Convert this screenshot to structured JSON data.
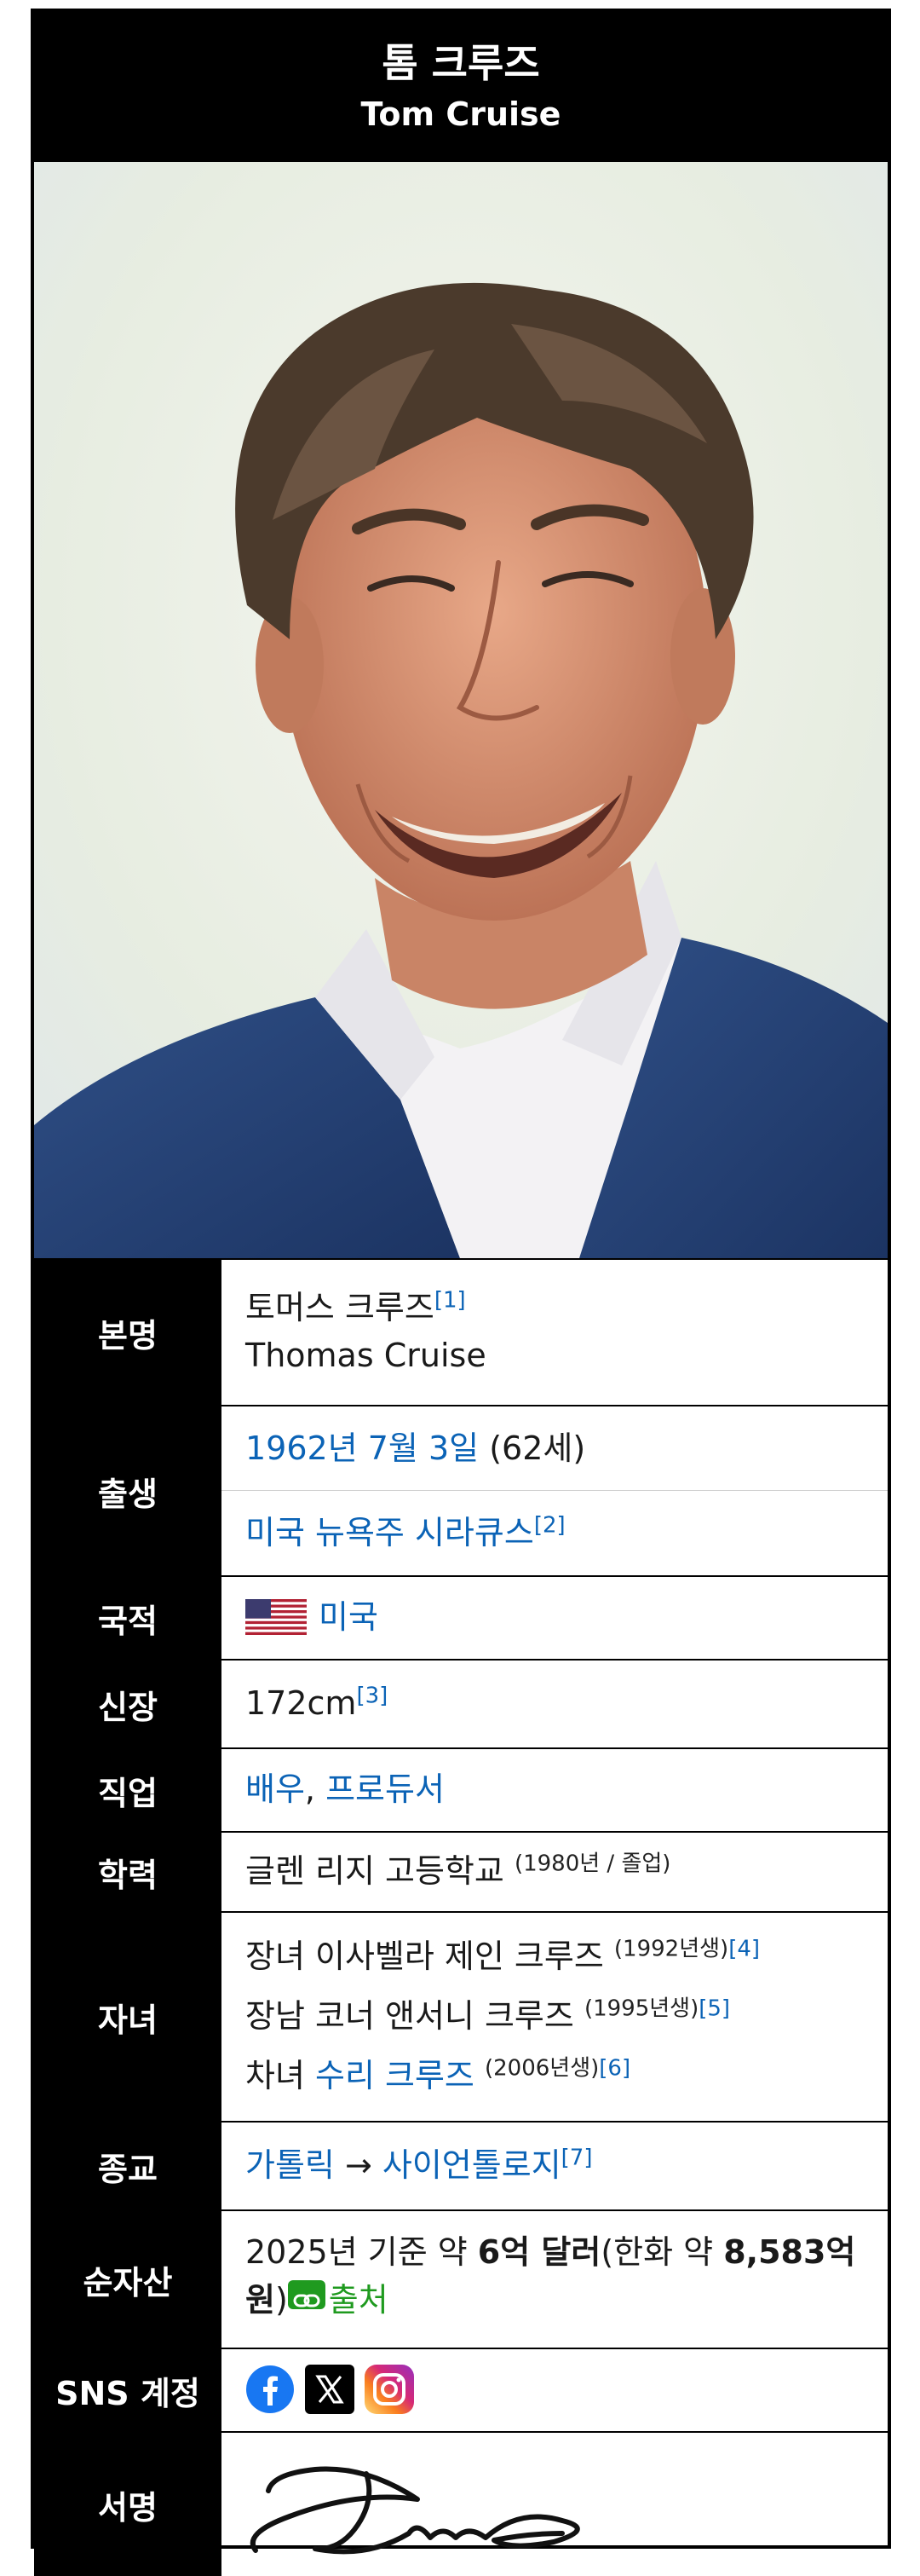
{
  "title": {
    "korean": "톰 크루즈",
    "english": "Tom Cruise"
  },
  "rows": {
    "real_name": {
      "label": "본명",
      "ko": "토머스 크루즈",
      "ref": "[1]",
      "en": "Thomas Cruise"
    },
    "birth": {
      "label": "출생",
      "date": "1962년 7월 3일",
      "age": "(62세)",
      "place": "미국 뉴욕주 시라큐스",
      "ref": "[2]"
    },
    "nationality": {
      "label": "국적",
      "country": "미국",
      "flag_icon": "us-flag-icon"
    },
    "height": {
      "label": "신장",
      "value": "172cm",
      "ref": "[3]"
    },
    "occupation": {
      "label": "직업",
      "first": "배우",
      "sep": ", ",
      "second": "프로듀서"
    },
    "education": {
      "label": "학력",
      "school": "글렌 리지 고등학교",
      "note": "(1980년 / 졸업)"
    },
    "children": {
      "label": "자녀",
      "items": [
        {
          "prefix": "장녀 이사벨라 제인 크루즈",
          "link": "",
          "year": "(1992년생)",
          "ref": "[4]"
        },
        {
          "prefix": "장남 코너 앤서니 크루즈",
          "link": "",
          "year": "(1995년생)",
          "ref": "[5]"
        },
        {
          "prefix": "차녀 ",
          "link": "수리 크루즈",
          "year": "(2006년생)",
          "ref": "[6]"
        }
      ]
    },
    "religion": {
      "label": "종교",
      "from": "가톨릭",
      "arrow": " → ",
      "to": "사이언톨로지",
      "ref": "[7]"
    },
    "net_worth": {
      "label": "순자산",
      "prefix": "2025년 기준 약 ",
      "usd": "6억 달러",
      "mid": "(한화 약 ",
      "krw": "8,583억 원",
      "close": ")",
      "source": "출처"
    },
    "sns": {
      "label": "SNS 계정",
      "icons": [
        "facebook-icon",
        "x-icon",
        "instagram-icon"
      ]
    },
    "signature": {
      "label": "서명"
    }
  },
  "colors": {
    "header_bg": "#000000",
    "link": "#0b63b6",
    "source": "#1f9a1f"
  }
}
